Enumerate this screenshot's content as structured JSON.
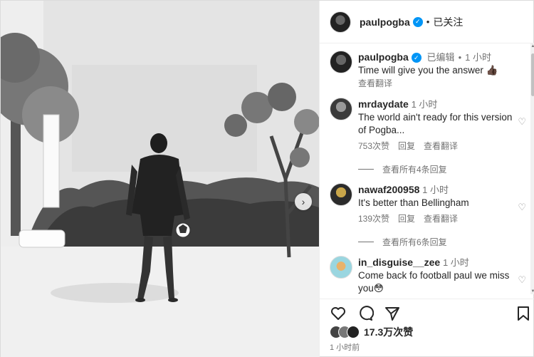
{
  "post": {
    "author": "paulpogba",
    "follow_status": "已关注",
    "caption": "Time will give you the answer",
    "caption_emoji": "👍🏿",
    "edited_label": "已编辑",
    "caption_time": "1 小时",
    "translate_label": "查看翻译"
  },
  "comments": [
    {
      "user": "mrdaydate",
      "time": "1 小时",
      "text": "The world ain't ready for this version of Pogba...",
      "likes": "753次赞",
      "reply": "回复",
      "translate": "查看翻译",
      "view_replies": "查看所有4条回复"
    },
    {
      "user": "nawaf200958",
      "time": "1 小时",
      "text": "It's better than Bellingham",
      "likes": "139次赞",
      "reply": "回复",
      "translate": "查看翻译",
      "view_replies": "查看所有6条回复"
    },
    {
      "user": "in_disguise__zee",
      "time": "1 小时",
      "text": "Come back fo football paul we miss you😳"
    }
  ],
  "footer": {
    "likes": "17.3万次赞",
    "time": "1 小时前"
  },
  "icons": {
    "like": "heart-icon",
    "comment": "comment-icon",
    "share": "share-icon",
    "save": "bookmark-icon",
    "next": "chevron-right-icon",
    "verified": "verified-badge-icon"
  },
  "colors": {
    "verified": "#0095f6",
    "muted": "#737373"
  }
}
